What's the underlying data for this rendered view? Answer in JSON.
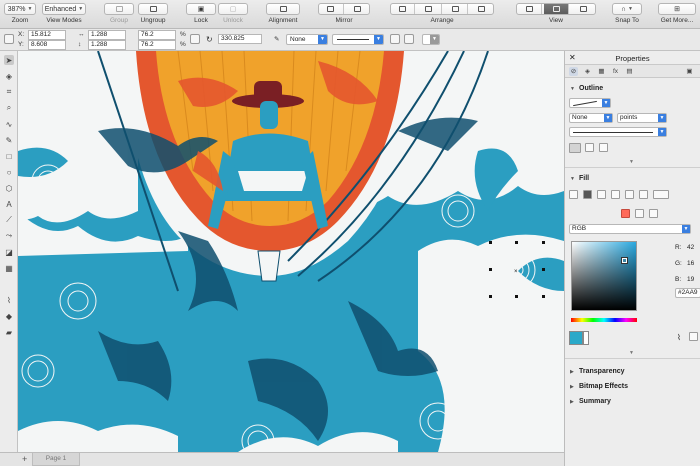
{
  "toolbar": {
    "zoom": {
      "value": "387%",
      "label": "Zoom"
    },
    "view_modes": {
      "value": "Enhanced",
      "label": "View Modes"
    },
    "group": {
      "label": "Group"
    },
    "ungroup": {
      "label": "Ungroup"
    },
    "lock": {
      "label": "Lock"
    },
    "unlock": {
      "label": "Unlock"
    },
    "alignment": {
      "label": "Alignment"
    },
    "mirror": {
      "label": "Mirror"
    },
    "arrange": {
      "label": "Arrange"
    },
    "view": {
      "label": "View"
    },
    "snap_to": {
      "label": "Snap To"
    },
    "get_more": {
      "label": "Get More..."
    }
  },
  "property_bar": {
    "x_label": "X:",
    "x_value": "15.812",
    "y_label": "Y:",
    "y_value": "8.608",
    "width_value": "1.288",
    "height_value": "1.288",
    "scale_w": "76.2",
    "scale_h": "76.2",
    "percent": "%",
    "rotation": "330.825",
    "outline_none": "None"
  },
  "panel": {
    "title": "Properties",
    "outline": {
      "title": "Outline",
      "none_value": "None",
      "units_value": "points"
    },
    "fill": {
      "title": "Fill",
      "model_value": "RGB",
      "r_label": "R:",
      "r_value": "42",
      "g_label": "G:",
      "g_value": "16",
      "b_label": "B:",
      "b_value": "19",
      "hex_value": "#2AA9"
    },
    "transparency": {
      "title": "Transparency"
    },
    "bitmap_effects": {
      "title": "Bitmap Effects"
    },
    "summary": {
      "title": "Summary"
    }
  },
  "bottom": {
    "add_page": "+",
    "page_tab": "Page 1"
  },
  "colors": {
    "fill_swatch": "#2aa9c9",
    "sky_blue": "#2b9ec1",
    "dark_navy": "#0f4f6e",
    "orange": "#f0a22b",
    "red_orange": "#e4572e",
    "accent_blue": "#3a7fe0"
  }
}
